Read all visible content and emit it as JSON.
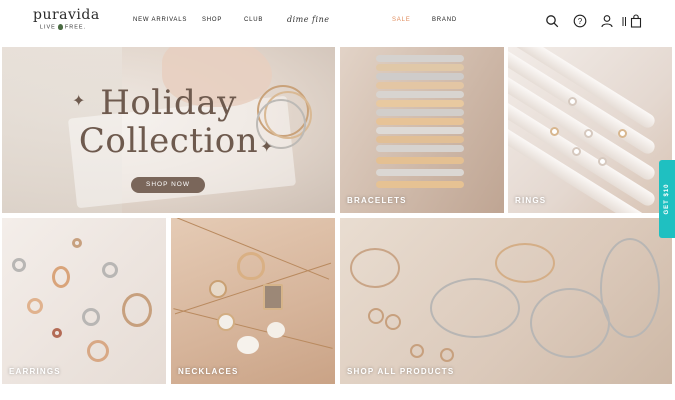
{
  "brand": {
    "name": "puravida",
    "tagline_left": "LIVE",
    "tagline_right": "FREE."
  },
  "nav": {
    "items": [
      {
        "label": "NEW ARRIVALS"
      },
      {
        "label": "SHOP"
      },
      {
        "label": "CLUB"
      },
      {
        "label": "dime fine"
      },
      {
        "label": "SALE"
      },
      {
        "label": "BRAND"
      }
    ],
    "icons": [
      "search-icon",
      "help-icon",
      "account-icon",
      "wishlist-icon",
      "bag-icon"
    ]
  },
  "hero": {
    "title_line1": "Holiday",
    "title_line2": "Collection",
    "cta": "SHOP NOW"
  },
  "tiles": {
    "bracelets": "BRACELETS",
    "rings": "RINGS",
    "earrings": "EARRINGS",
    "necklaces": "NECKLACES",
    "shop_all": "SHOP ALL PRODUCTS"
  },
  "side_tab": {
    "label": "GET $10"
  },
  "colors": {
    "sale": "#e08c5d",
    "cta_bg": "#7a665a",
    "side_tab": "#1fc0c1"
  }
}
